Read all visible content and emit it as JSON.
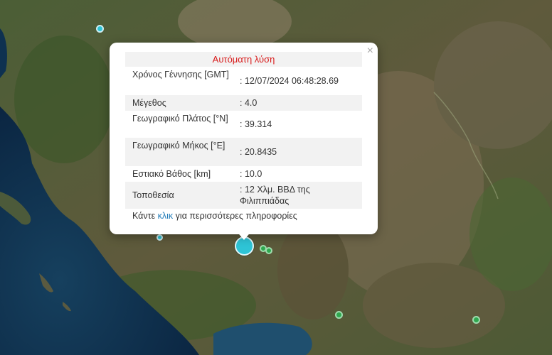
{
  "map": {
    "colors": {
      "sea_deep": "#0c2a4a",
      "sea_shallow": "#1d5a6b",
      "land_green": "#3f5a2e",
      "land_brown": "#6e5a3a",
      "mountain": "#8a7760",
      "marker_cyan": "#2ec4d6",
      "marker_green": "#2fa84f"
    }
  },
  "popup": {
    "title": "Αυτόματη λύση",
    "close_symbol": "×",
    "rows": [
      {
        "label": "Χρόνος Γέννησης [GMT]",
        "value": ": 12/07/2024 06:48:28.69"
      },
      {
        "label": "Μέγεθος",
        "value": ": 4.0"
      },
      {
        "label": "Γεωγραφικό Πλάτος [°N]",
        "value": ": 39.314"
      },
      {
        "label": "Γεωγραφικό Μήκος [°E]",
        "value": ": 20.8435"
      },
      {
        "label": "Εστιακό Βάθος [km]",
        "value": ": 10.0"
      },
      {
        "label": "Τοποθεσία",
        "value": ": 12 Χλμ. ΒΒΔ της Φιλιππιάδας"
      }
    ],
    "more": {
      "before": "Κάντε ",
      "link": "κλικ",
      "after": " για περισσότερες πληροφορίες"
    }
  }
}
